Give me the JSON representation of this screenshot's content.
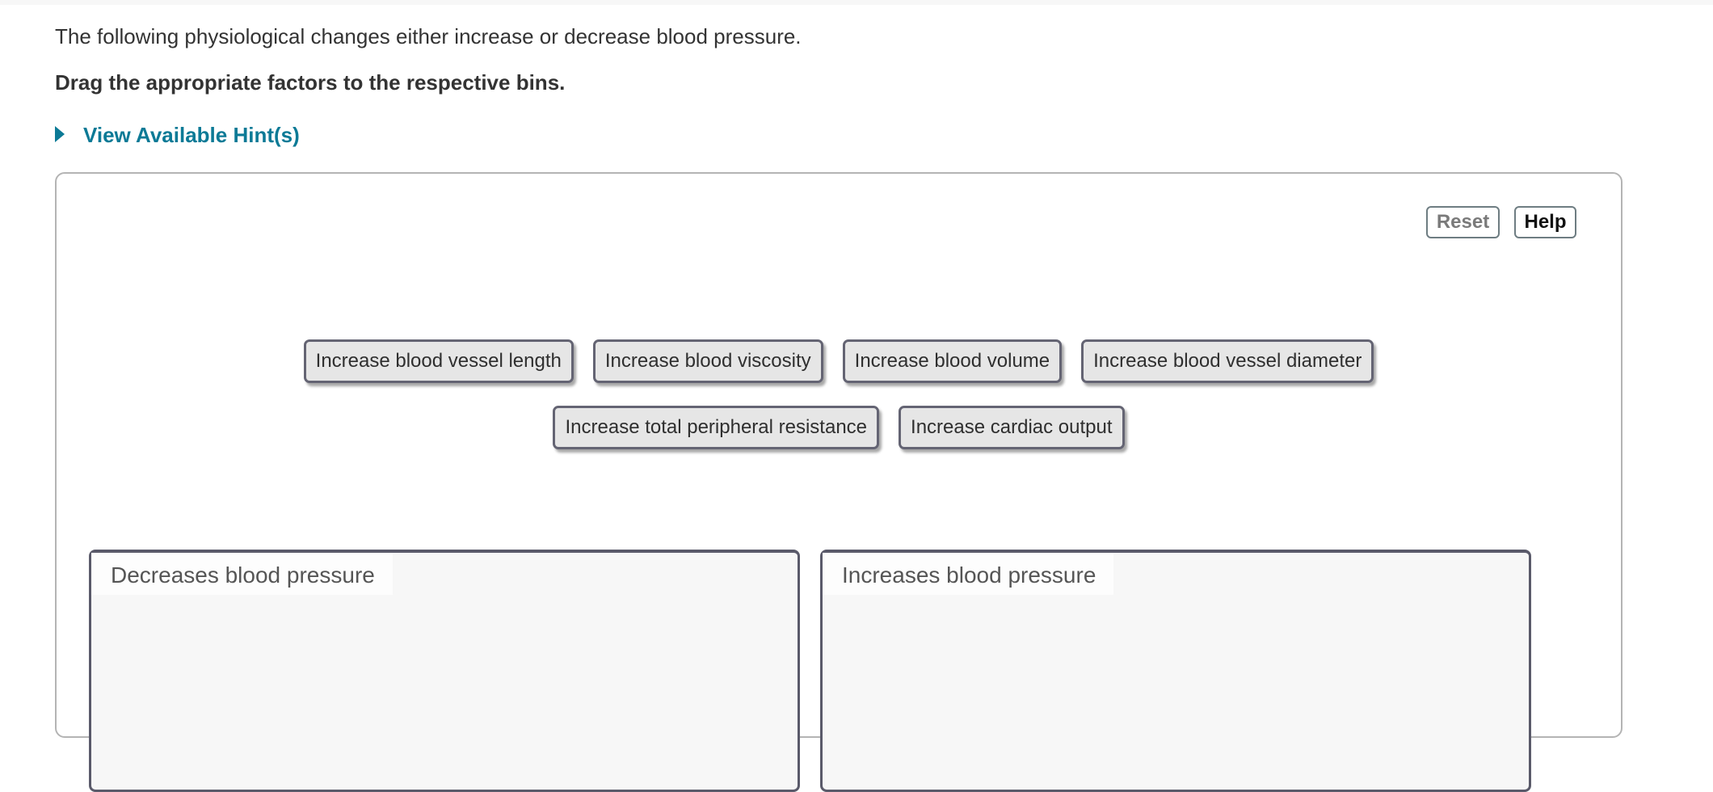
{
  "question": {
    "intro": "The following physiological changes either increase or decrease blood pressure.",
    "instruction": "Drag the appropriate factors to the respective bins.",
    "hint_link": "View Available Hint(s)"
  },
  "toolbar": {
    "reset_label": "Reset",
    "help_label": "Help"
  },
  "factors": {
    "row1": [
      "Increase blood vessel length",
      "Increase blood viscosity",
      "Increase blood volume",
      "Increase blood vessel diameter"
    ],
    "row2": [
      "Increase total peripheral resistance",
      "Increase cardiac output"
    ]
  },
  "bins": [
    {
      "label": "Decreases blood pressure",
      "items": []
    },
    {
      "label": "Increases blood pressure",
      "items": []
    }
  ],
  "colors": {
    "link": "#0c7a96",
    "chip_bg": "#e6e6e6",
    "chip_border": "#646473",
    "bin_bg": "#f7f7f7"
  }
}
